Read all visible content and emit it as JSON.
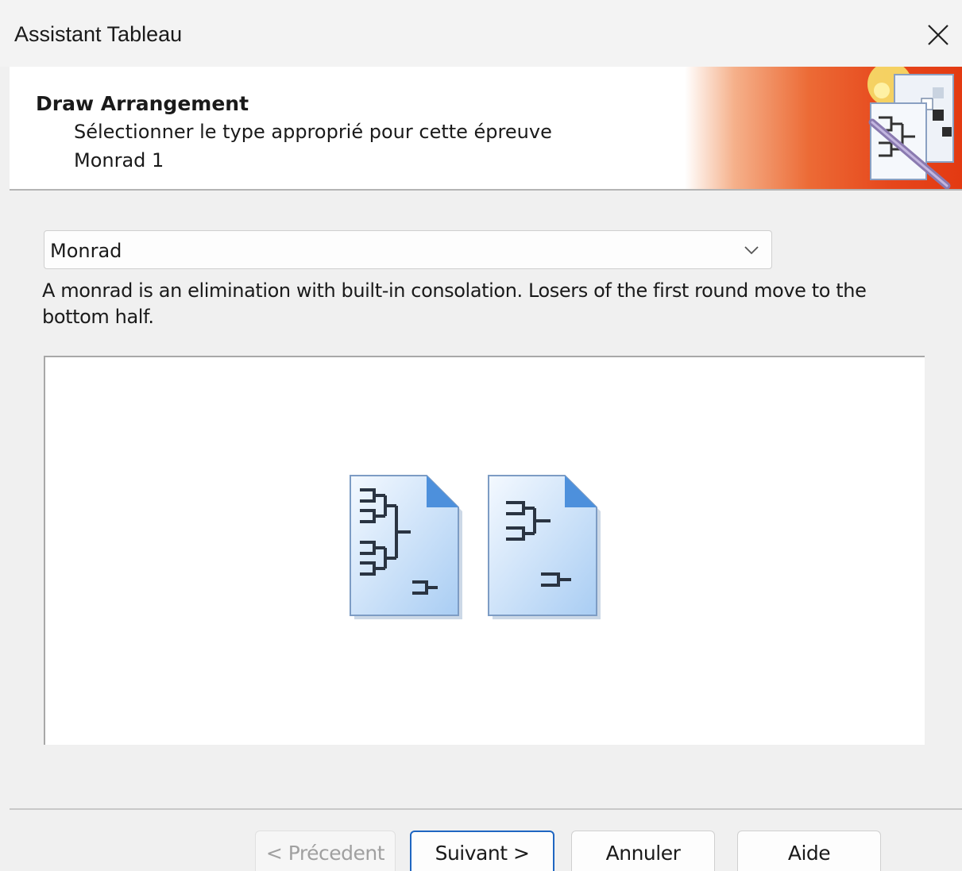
{
  "window": {
    "title": "Assistant Tableau",
    "close_icon": "close-icon"
  },
  "header": {
    "title": "Draw Arrangement",
    "subtitle": "Sélectionner le type approprié pour cette épreuve",
    "event_name": "Monrad 1",
    "logo_icon": "draw-wizard-icon",
    "accent_color": "#e6461b"
  },
  "draw_type": {
    "selected": "Monrad",
    "arrow_icon": "chevron-down-icon",
    "description": "A monrad is an elimination with built-in consolation. Losers of the first round move to the bottom half."
  },
  "preview": {
    "icons": [
      "main-draw-bracket-icon",
      "consolation-bracket-icon"
    ]
  },
  "buttons": {
    "previous": "< Précedent",
    "next": "Suivant >",
    "cancel": "Annuler",
    "help": "Aide"
  }
}
